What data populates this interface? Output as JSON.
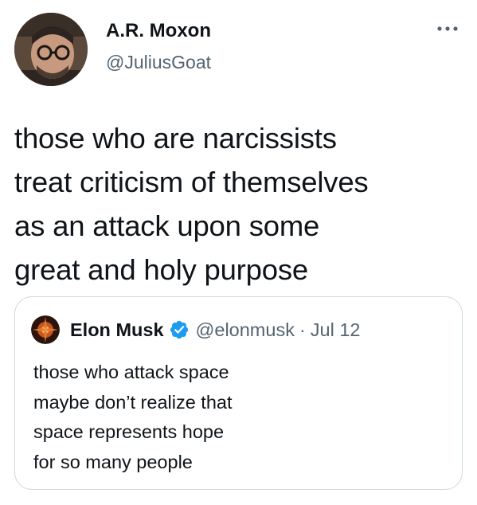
{
  "tweet": {
    "author": {
      "name": "A.R. Moxon",
      "handle": "@JuliusGoat",
      "avatar_icon": "profile-photo"
    },
    "more_icon": "more-dots-icon",
    "text": "those who are narcissists\ntreat criticism of themselves\nas an attack upon some\ngreat and holy purpose"
  },
  "quote": {
    "author": {
      "name": "Elon Musk",
      "verified": true,
      "verified_icon": "verified-badge-icon",
      "handle": "@elonmusk",
      "separator": "·",
      "date": "Jul 12",
      "avatar_icon": "profile-photo"
    },
    "text": "those who attack space\nmaybe don’t realize that\nspace represents hope\nfor so many people"
  },
  "colors": {
    "text_primary": "#0f1419",
    "text_secondary": "#536471",
    "border": "#cfd9de",
    "verified": "#1d9bf0"
  }
}
